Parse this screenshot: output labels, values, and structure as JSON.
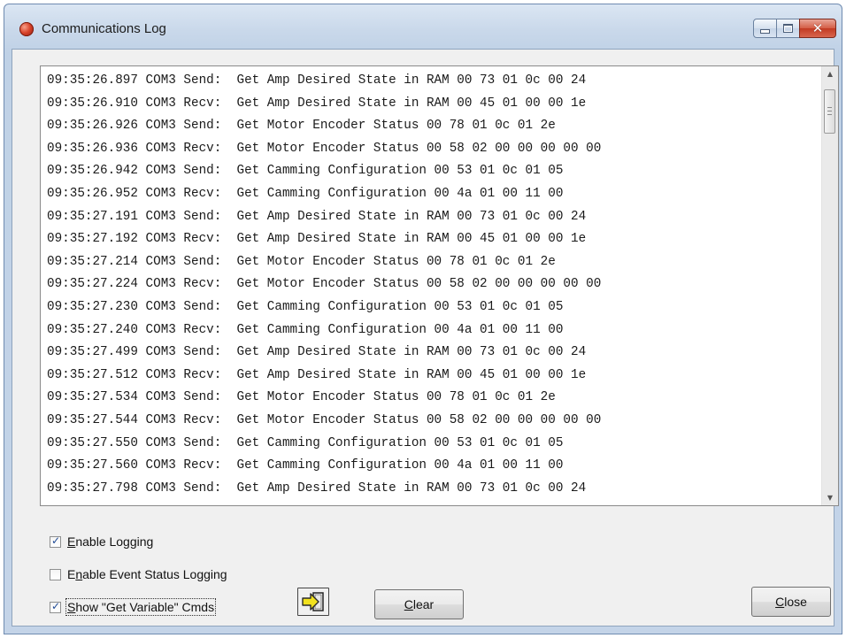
{
  "window": {
    "title": "Communications Log",
    "icon": "app-icon",
    "caption_buttons": {
      "minimize": "minimize-icon",
      "maximize": "maximize-icon",
      "close": "close-icon"
    },
    "close_color": "#c8432b"
  },
  "log": {
    "lines": [
      "09:35:26.897 COM3 Send:  Get Amp Desired State in RAM 00 73 01 0c 00 24",
      "09:35:26.910 COM3 Recv:  Get Amp Desired State in RAM 00 45 01 00 00 1e",
      "09:35:26.926 COM3 Send:  Get Motor Encoder Status 00 78 01 0c 01 2e",
      "09:35:26.936 COM3 Recv:  Get Motor Encoder Status 00 58 02 00 00 00 00 00",
      "09:35:26.942 COM3 Send:  Get Camming Configuration 00 53 01 0c 01 05",
      "09:35:26.952 COM3 Recv:  Get Camming Configuration 00 4a 01 00 11 00",
      "09:35:27.191 COM3 Send:  Get Amp Desired State in RAM 00 73 01 0c 00 24",
      "09:35:27.192 COM3 Recv:  Get Amp Desired State in RAM 00 45 01 00 00 1e",
      "09:35:27.214 COM3 Send:  Get Motor Encoder Status 00 78 01 0c 01 2e",
      "09:35:27.224 COM3 Recv:  Get Motor Encoder Status 00 58 02 00 00 00 00 00",
      "09:35:27.230 COM3 Send:  Get Camming Configuration 00 53 01 0c 01 05",
      "09:35:27.240 COM3 Recv:  Get Camming Configuration 00 4a 01 00 11 00",
      "09:35:27.499 COM3 Send:  Get Amp Desired State in RAM 00 73 01 0c 00 24",
      "09:35:27.512 COM3 Recv:  Get Amp Desired State in RAM 00 45 01 00 00 1e",
      "09:35:27.534 COM3 Send:  Get Motor Encoder Status 00 78 01 0c 01 2e",
      "09:35:27.544 COM3 Recv:  Get Motor Encoder Status 00 58 02 00 00 00 00 00",
      "09:35:27.550 COM3 Send:  Get Camming Configuration 00 53 01 0c 01 05",
      "09:35:27.560 COM3 Recv:  Get Camming Configuration 00 4a 01 00 11 00",
      "09:35:27.798 COM3 Send:  Get Amp Desired State in RAM 00 73 01 0c 00 24"
    ]
  },
  "options": {
    "enable_logging": {
      "prefix": "",
      "accel": "E",
      "rest": "nable Logging",
      "checked": true
    },
    "enable_event_status_logging": {
      "prefix": "E",
      "accel": "n",
      "rest": "able Event Status Logging",
      "checked": false
    },
    "show_get_variable_cmds": {
      "prefix": "",
      "accel": "S",
      "rest": "how \"Get Variable\" Cmds",
      "checked": true
    }
  },
  "buttons": {
    "export_icon": "export-to-file-icon",
    "clear": {
      "accel": "C",
      "rest": "lear"
    },
    "close": {
      "accel": "C",
      "rest": "lose"
    }
  }
}
